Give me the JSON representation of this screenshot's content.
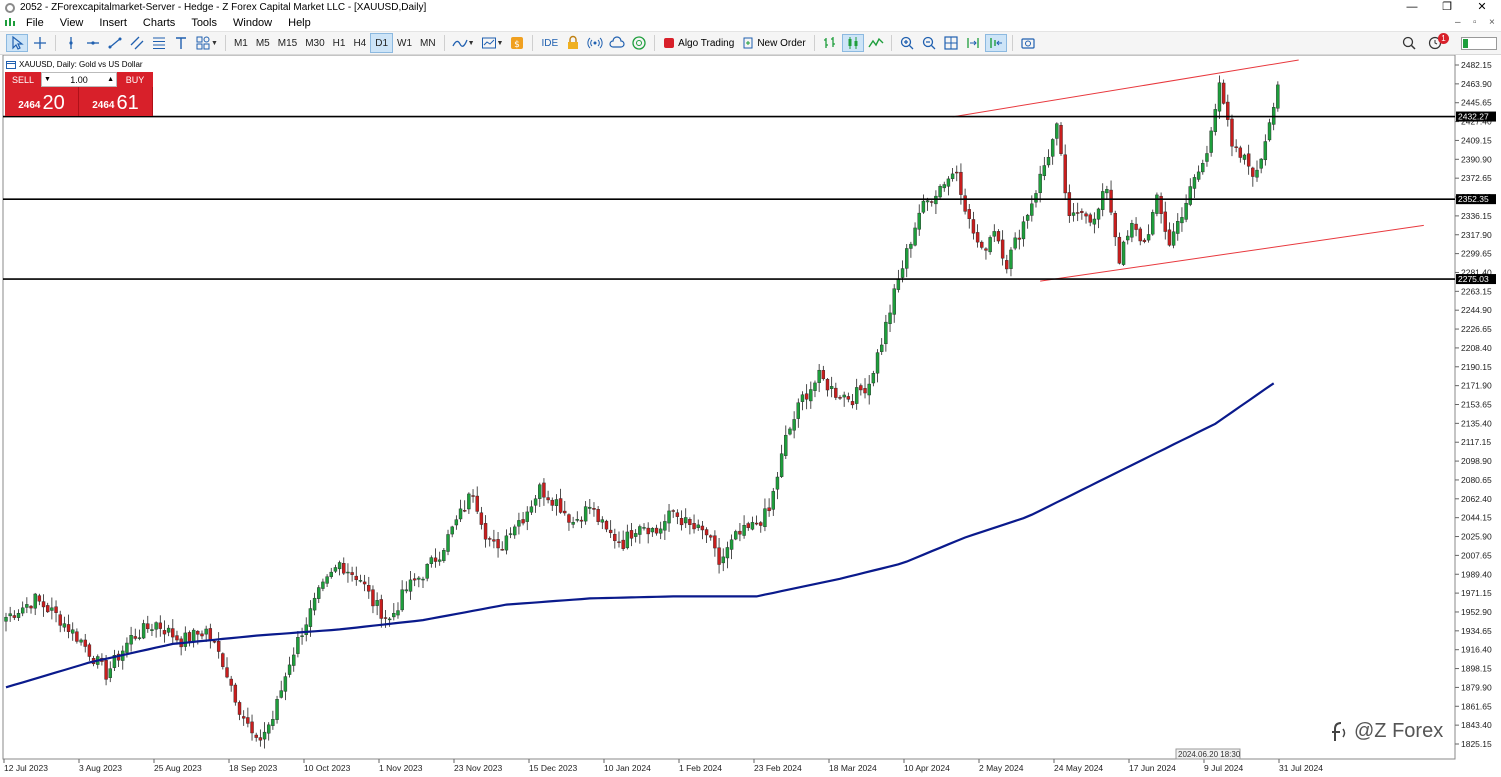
{
  "window": {
    "title": "2052 - ZForexcapitalmarket-Server - Hedge - Z Forex Capital Market LLC - [XAUUSD,Daily]",
    "controls": [
      "—",
      "❐",
      "✕"
    ]
  },
  "menu": {
    "items": [
      "File",
      "View",
      "Insert",
      "Charts",
      "Tools",
      "Window",
      "Help"
    ],
    "right_controls": [
      "–",
      "▫",
      "×"
    ]
  },
  "toolbar": {
    "timeframes": [
      "M1",
      "M5",
      "M15",
      "M30",
      "H1",
      "H4",
      "D1",
      "W1",
      "MN"
    ],
    "selected_timeframe": "D1",
    "ide_label": "IDE",
    "algo_label": "Algo Trading",
    "new_order_label": "New Order",
    "notification_count": "1"
  },
  "chart_info": {
    "symbol_line": "XAUUSD, Daily:  Gold vs US Dollar"
  },
  "trade_panel": {
    "sell_label": "SELL",
    "buy_label": "BUY",
    "lot": "1.00",
    "sell_price_small": "2464",
    "sell_price_big": "20",
    "buy_price_small": "2464",
    "buy_price_big": "61"
  },
  "watermark": {
    "text": "@Z Forex"
  },
  "colors": {
    "bull": "#1e9e3c",
    "bear": "#c81e1e",
    "ma": "#0a1a8c",
    "channel": "#e8383d",
    "level": "#000000"
  },
  "chart_data": {
    "type": "candlestick",
    "symbol": "XAUUSD",
    "timeframe": "Daily",
    "ylim": [
      1825.15,
      2482.15
    ],
    "y_ticks": [
      2482.15,
      2463.9,
      2445.65,
      2427.4,
      2409.15,
      2390.9,
      2372.65,
      2354.4,
      2336.15,
      2317.9,
      2299.65,
      2281.4,
      2263.15,
      2244.9,
      2226.65,
      2208.4,
      2190.15,
      2171.9,
      2153.65,
      2135.4,
      2117.15,
      2098.9,
      2080.65,
      2062.4,
      2044.15,
      2025.9,
      2007.65,
      1989.4,
      1971.15,
      1952.9,
      1934.65,
      1916.4,
      1898.15,
      1879.9,
      1861.65,
      1843.4,
      1825.15
    ],
    "x_labels": [
      "12 Jul 2023",
      "3 Aug 2023",
      "25 Aug 2023",
      "18 Sep 2023",
      "10 Oct 2023",
      "1 Nov 2023",
      "23 Nov 2023",
      "15 Dec 2023",
      "10 Jan 2024",
      "1 Feb 2024",
      "23 Feb 2024",
      "18 Mar 2024",
      "10 Apr 2024",
      "2 May 2024",
      "24 May 2024",
      "17 Jun 2024",
      "9 Jul 2024",
      "31 Jul 2024"
    ],
    "horizontal_levels": [
      {
        "price": 2432.27,
        "label": "2432.27"
      },
      {
        "price": 2352.35,
        "label": "2352.35"
      },
      {
        "price": 2275.03,
        "label": "2275.03"
      }
    ],
    "bottom_tag": "2024.06.20 18:30",
    "anchors": [
      {
        "i": 0,
        "p": 1948
      },
      {
        "i": 7,
        "p": 1965
      },
      {
        "i": 12,
        "p": 1950
      },
      {
        "i": 18,
        "p": 1925
      },
      {
        "i": 24,
        "p": 1893
      },
      {
        "i": 30,
        "p": 1928
      },
      {
        "i": 36,
        "p": 1942
      },
      {
        "i": 42,
        "p": 1925
      },
      {
        "i": 48,
        "p": 1935
      },
      {
        "i": 52,
        "p": 1905
      },
      {
        "i": 56,
        "p": 1860
      },
      {
        "i": 60,
        "p": 1825
      },
      {
        "i": 64,
        "p": 1850
      },
      {
        "i": 68,
        "p": 1905
      },
      {
        "i": 71,
        "p": 1935
      },
      {
        "i": 75,
        "p": 1970
      },
      {
        "i": 80,
        "p": 2000
      },
      {
        "i": 85,
        "p": 1985
      },
      {
        "i": 88,
        "p": 1962
      },
      {
        "i": 92,
        "p": 1945
      },
      {
        "i": 96,
        "p": 1975
      },
      {
        "i": 100,
        "p": 1990
      },
      {
        "i": 104,
        "p": 2010
      },
      {
        "i": 108,
        "p": 2040
      },
      {
        "i": 112,
        "p": 2070
      },
      {
        "i": 115,
        "p": 2030
      },
      {
        "i": 118,
        "p": 2010
      },
      {
        "i": 121,
        "p": 2035
      },
      {
        "i": 124,
        "p": 2045
      },
      {
        "i": 128,
        "p": 2072
      },
      {
        "i": 132,
        "p": 2060
      },
      {
        "i": 136,
        "p": 2040
      },
      {
        "i": 140,
        "p": 2055
      },
      {
        "i": 144,
        "p": 2030
      },
      {
        "i": 148,
        "p": 2020
      },
      {
        "i": 152,
        "p": 2040
      },
      {
        "i": 156,
        "p": 2030
      },
      {
        "i": 160,
        "p": 2050
      },
      {
        "i": 164,
        "p": 2035
      },
      {
        "i": 168,
        "p": 2028
      },
      {
        "i": 171,
        "p": 2000
      },
      {
        "i": 175,
        "p": 2025
      },
      {
        "i": 179,
        "p": 2035
      },
      {
        "i": 183,
        "p": 2050
      },
      {
        "i": 187,
        "p": 2120
      },
      {
        "i": 191,
        "p": 2160
      },
      {
        "i": 195,
        "p": 2180
      },
      {
        "i": 199,
        "p": 2165
      },
      {
        "i": 203,
        "p": 2160
      },
      {
        "i": 207,
        "p": 2175
      },
      {
        "i": 210,
        "p": 2215
      },
      {
        "i": 213,
        "p": 2260
      },
      {
        "i": 216,
        "p": 2300
      },
      {
        "i": 219,
        "p": 2340
      },
      {
        "i": 222,
        "p": 2355
      },
      {
        "i": 225,
        "p": 2370
      },
      {
        "i": 228,
        "p": 2380
      },
      {
        "i": 231,
        "p": 2330
      },
      {
        "i": 234,
        "p": 2300
      },
      {
        "i": 237,
        "p": 2325
      },
      {
        "i": 240,
        "p": 2290
      },
      {
        "i": 243,
        "p": 2320
      },
      {
        "i": 246,
        "p": 2350
      },
      {
        "i": 249,
        "p": 2385
      },
      {
        "i": 252,
        "p": 2420
      },
      {
        "i": 255,
        "p": 2330
      },
      {
        "i": 258,
        "p": 2345
      },
      {
        "i": 261,
        "p": 2330
      },
      {
        "i": 264,
        "p": 2365
      },
      {
        "i": 267,
        "p": 2295
      },
      {
        "i": 270,
        "p": 2325
      },
      {
        "i": 273,
        "p": 2310
      },
      {
        "i": 276,
        "p": 2350
      },
      {
        "i": 279,
        "p": 2310
      },
      {
        "i": 282,
        "p": 2340
      },
      {
        "i": 285,
        "p": 2370
      },
      {
        "i": 288,
        "p": 2395
      },
      {
        "i": 291,
        "p": 2470
      },
      {
        "i": 294,
        "p": 2400
      },
      {
        "i": 297,
        "p": 2390
      },
      {
        "i": 300,
        "p": 2375
      },
      {
        "i": 303,
        "p": 2430
      },
      {
        "i": 305,
        "p": 2465
      }
    ],
    "ma_points": [
      {
        "i": 0,
        "p": 1880
      },
      {
        "i": 20,
        "p": 1904
      },
      {
        "i": 40,
        "p": 1922
      },
      {
        "i": 60,
        "p": 1930
      },
      {
        "i": 80,
        "p": 1936
      },
      {
        "i": 100,
        "p": 1945
      },
      {
        "i": 120,
        "p": 1960
      },
      {
        "i": 140,
        "p": 1966
      },
      {
        "i": 160,
        "p": 1968
      },
      {
        "i": 180,
        "p": 1968
      },
      {
        "i": 200,
        "p": 1985
      },
      {
        "i": 215,
        "p": 2000
      },
      {
        "i": 230,
        "p": 2025
      },
      {
        "i": 245,
        "p": 2045
      },
      {
        "i": 260,
        "p": 2075
      },
      {
        "i": 275,
        "p": 2105
      },
      {
        "i": 290,
        "p": 2135
      },
      {
        "i": 305,
        "p": 2177
      }
    ],
    "channel_upper": [
      {
        "i": 227,
        "p": 2432
      },
      {
        "i": 310,
        "p": 2487
      }
    ],
    "channel_lower": [
      {
        "i": 248,
        "p": 2273
      },
      {
        "i": 340,
        "p": 2327
      }
    ]
  }
}
